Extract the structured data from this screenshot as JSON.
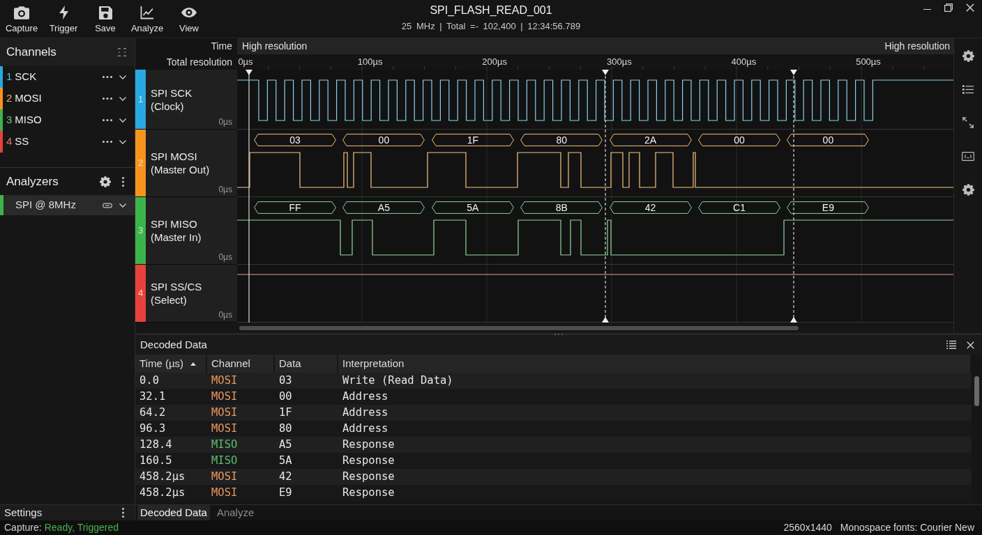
{
  "toolbar": [
    {
      "label": "Capture"
    },
    {
      "label": "Trigger"
    },
    {
      "label": "Save"
    },
    {
      "label": "Analyze"
    },
    {
      "label": "View"
    }
  ],
  "window": {
    "title": "SPI_FLASH_READ_001",
    "subtitle": "25 MHz | Total =- 102,400 | 12:34:56.789"
  },
  "sidebar": {
    "channels_title": "Channels",
    "channels": [
      {
        "number": "1",
        "name": "SCK",
        "color": "#29a9e1"
      },
      {
        "number": "2",
        "name": "MOSI",
        "color": "#f7941d"
      },
      {
        "number": "3",
        "name": "MISO",
        "color": "#3cb44b"
      },
      {
        "number": "4",
        "name": "SS",
        "color": "#e8413c"
      }
    ],
    "analyzers_title": "Analyzers",
    "analyzers": [
      {
        "label": "SPI @ 8MHz",
        "color": "#3cb44b"
      }
    ],
    "settings_label": "Settings"
  },
  "waveform_view": {
    "time_label": "Time",
    "time_mode": "High resolution",
    "time_mode_right": "High resolution",
    "resolution_label": "Total resolution",
    "axis_ticks": [
      "0µs",
      "100µs",
      "200µs",
      "300µs",
      "400µs",
      "500µs"
    ],
    "channels": [
      {
        "number": "1",
        "name": "SPI SCK",
        "description": "(Clock)",
        "offset": "0µs",
        "color": "#29a9e1"
      },
      {
        "number": "2",
        "name": "SPI MOSI",
        "description": "(Master Out)",
        "offset": "0µs",
        "color": "#f7941d",
        "packets": [
          "03",
          "00",
          "1F",
          "80",
          "2A",
          "00",
          "00"
        ]
      },
      {
        "number": "3",
        "name": "SPI MISO",
        "description": "(Master In)",
        "offset": "0µs",
        "color": "#3cb44b",
        "packets": [
          "FF",
          "A5",
          "5A",
          "8B",
          "42",
          "C1",
          "E9"
        ]
      },
      {
        "number": "4",
        "name": "SPI SS/CS",
        "description": "(Select)",
        "offset": "0µs",
        "color": "#e8413c"
      }
    ]
  },
  "decoded_data": {
    "title": "Decoded Data",
    "columns": [
      {
        "label": "Time (µs)",
        "sorted": true
      },
      {
        "label": "Channel",
        "sorted": false
      },
      {
        "label": "Data",
        "sorted": false
      },
      {
        "label": "Interpretation",
        "sorted": false
      }
    ],
    "rows": [
      {
        "time": "0.0",
        "channel": "MOSI",
        "color": "#e8975f",
        "data": "03",
        "interpretation": "Write (Read Data)"
      },
      {
        "time": "32.1",
        "channel": "MOSI",
        "color": "#e8975f",
        "data": "00",
        "interpretation": "Address"
      },
      {
        "time": "64.2",
        "channel": "MOSI",
        "color": "#e8975f",
        "data": "1F",
        "interpretation": "Address"
      },
      {
        "time": "96.3",
        "channel": "MOSI",
        "color": "#e8975f",
        "data": "80",
        "interpretation": "Address"
      },
      {
        "time": "128.4",
        "channel": "MISO",
        "color": "#5cbf6a",
        "data": "A5",
        "interpretation": "Response"
      },
      {
        "time": "160.5",
        "channel": "MISO",
        "color": "#5cbf6a",
        "data": "5A",
        "interpretation": "Response"
      },
      {
        "time": "458.2µs",
        "channel": "MOSI",
        "color": "#e8975f",
        "data": "42",
        "interpretation": "Response"
      },
      {
        "time": "458.2µs",
        "channel": "MOSI",
        "color": "#e8975f",
        "data": "E9",
        "interpretation": "Response"
      }
    ]
  },
  "bottom_tabs": [
    {
      "label": "Decoded Data",
      "selected": true
    },
    {
      "label": "Analyze",
      "selected": false
    }
  ],
  "status_bar": {
    "capture_label": "Capture:",
    "capture_state": "Ready, Triggered",
    "resolution": "2560x1440",
    "fonts": "Monospace fonts: Courier New"
  }
}
